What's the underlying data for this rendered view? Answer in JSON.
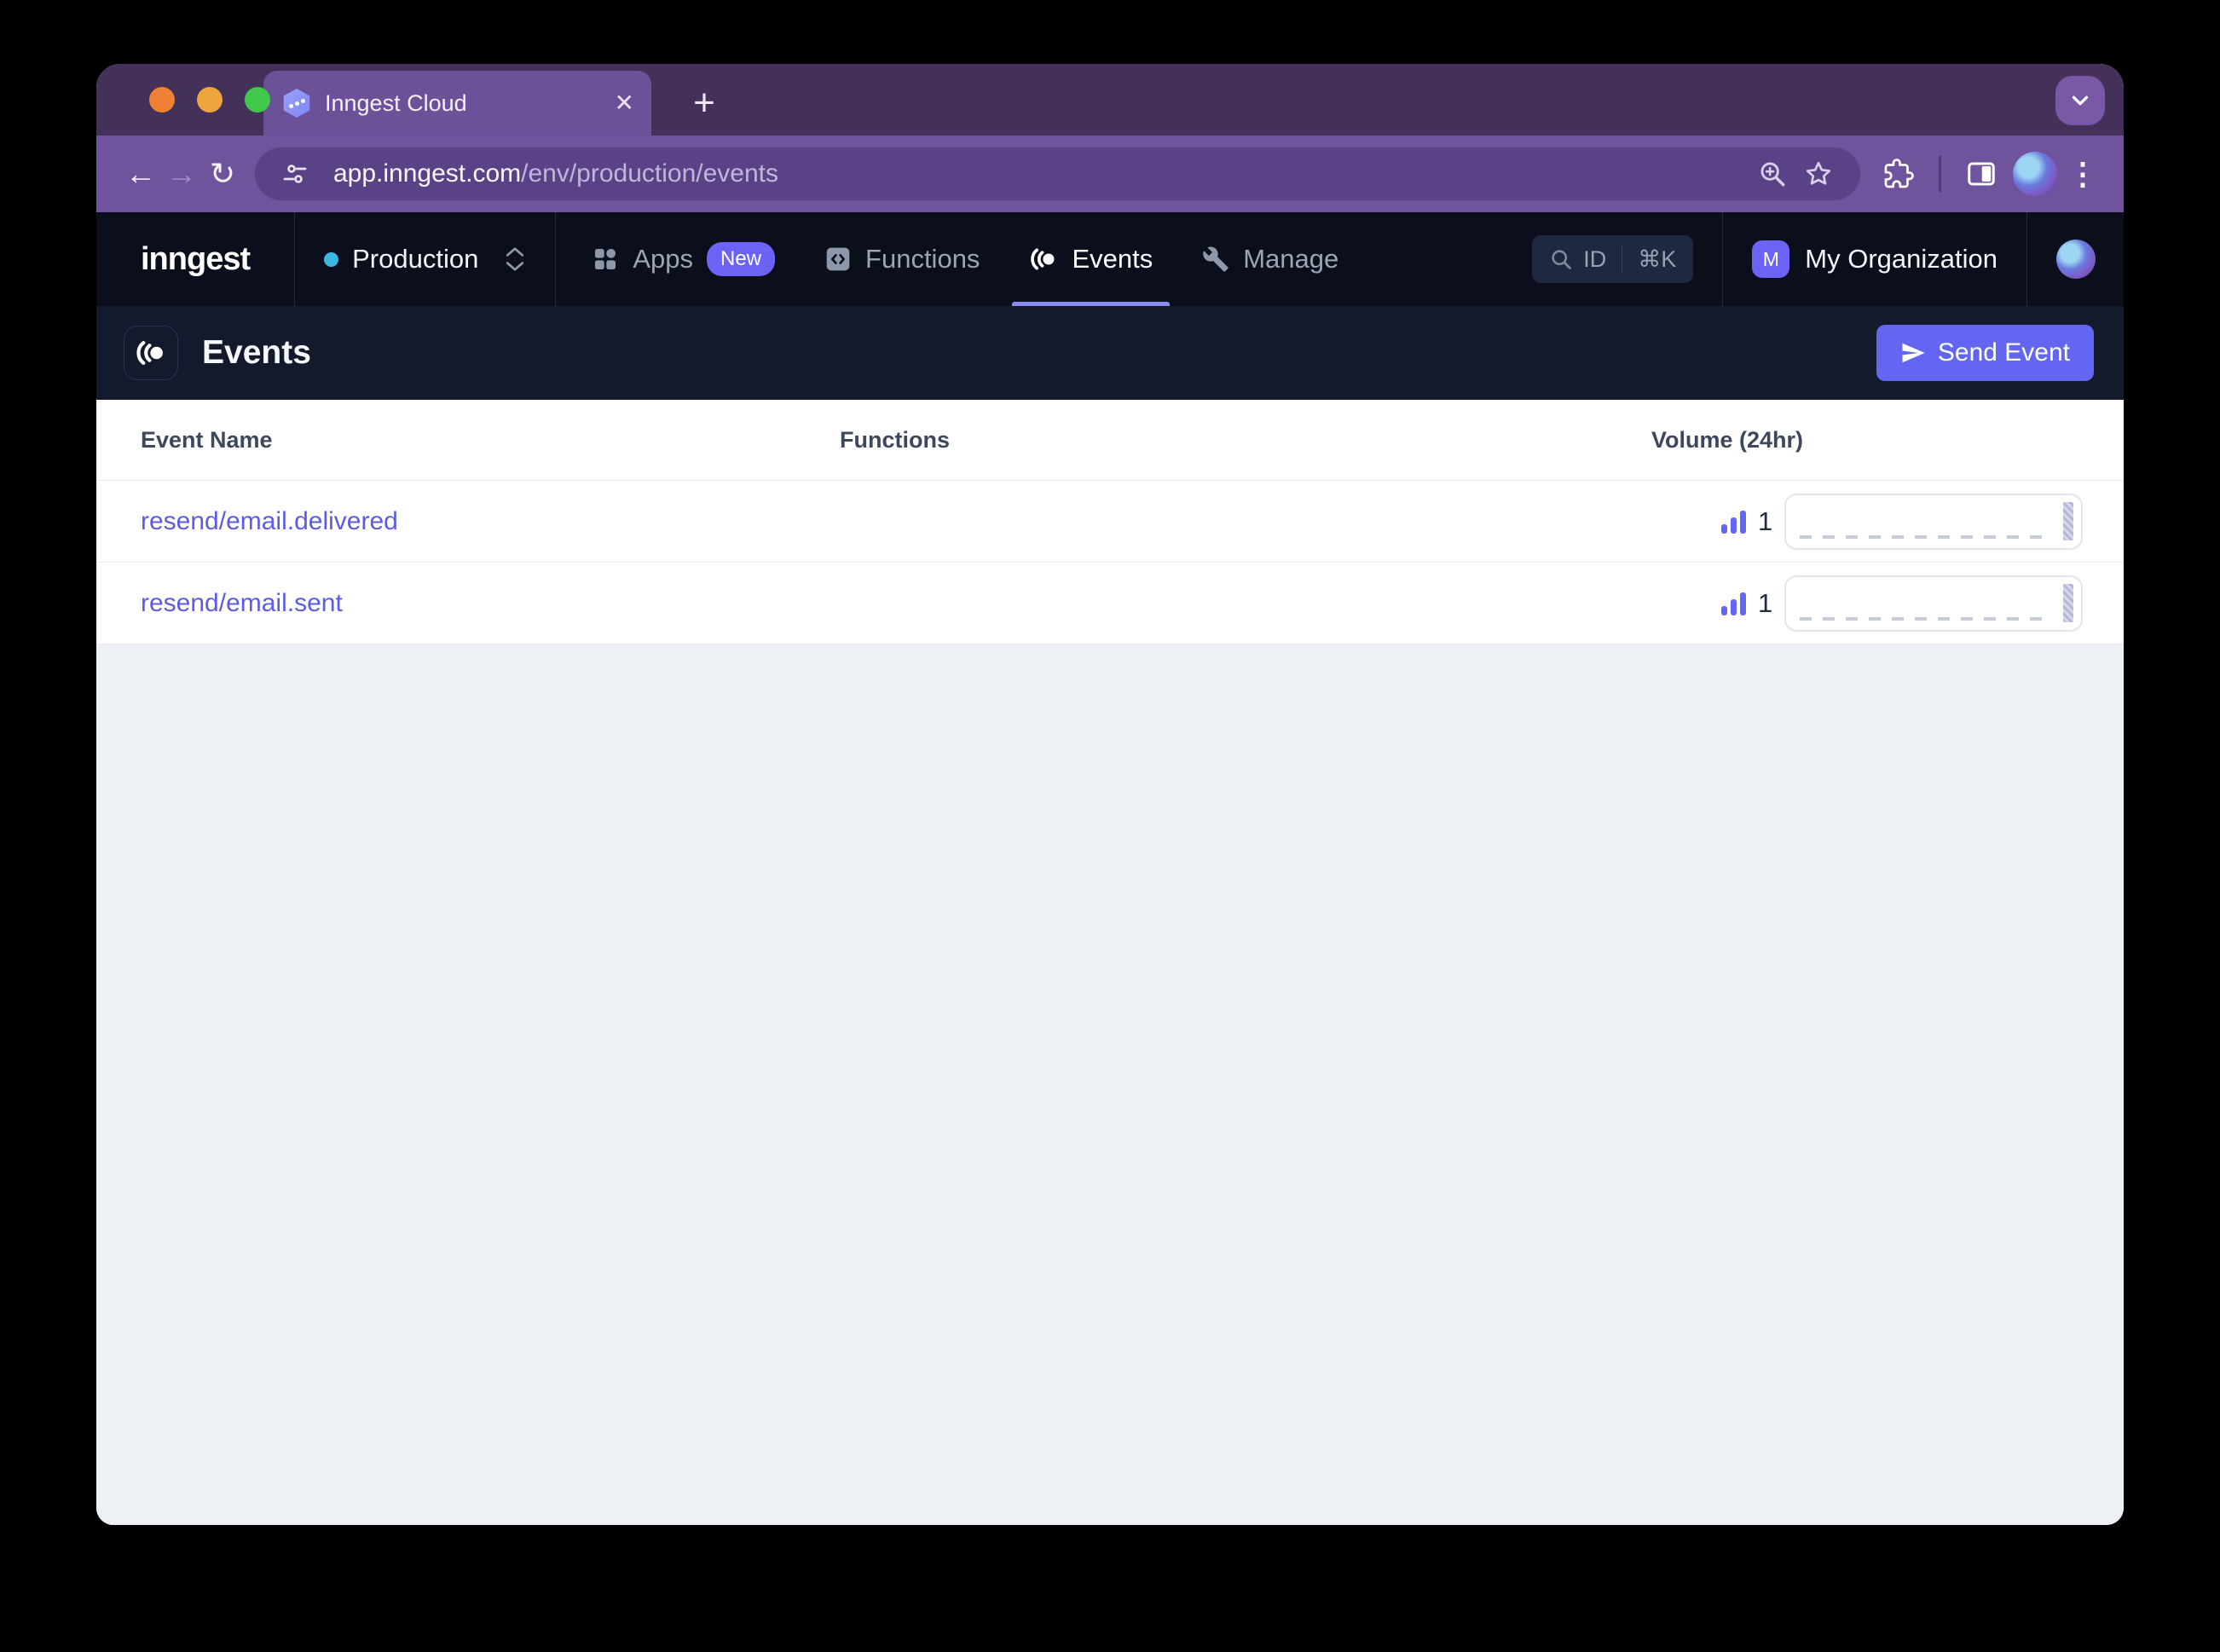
{
  "browser": {
    "tab": {
      "title": "Inngest Cloud"
    },
    "url": {
      "host": "app.inngest.com",
      "path": "/env/production/events"
    },
    "glyphs": {
      "back": "←",
      "forward": "→",
      "reload": "↻",
      "close": "✕",
      "new_tab": "+",
      "menu": "⋮"
    }
  },
  "nav": {
    "logo": "inngest",
    "environment": {
      "label": "Production"
    },
    "items": [
      {
        "label": "Apps",
        "badge": "New"
      },
      {
        "label": "Functions"
      },
      {
        "label": "Events"
      },
      {
        "label": "Manage"
      }
    ],
    "search": {
      "id_label": "ID",
      "shortcut": "⌘K"
    },
    "organization": {
      "initial": "M",
      "name": "My Organization"
    }
  },
  "page": {
    "title": "Events",
    "send_button_label": "Send Event"
  },
  "table": {
    "columns": [
      "Event Name",
      "Functions",
      "Volume (24hr)"
    ],
    "rows": [
      {
        "name": "resend/email.delivered",
        "volume": "1"
      },
      {
        "name": "resend/email.sent",
        "volume": "1"
      }
    ]
  },
  "colors": {
    "accent": "#6366F1",
    "link": "#5C5BE6",
    "env_dot": "#3CB7E3",
    "active_underline": "#8A8DF4"
  }
}
